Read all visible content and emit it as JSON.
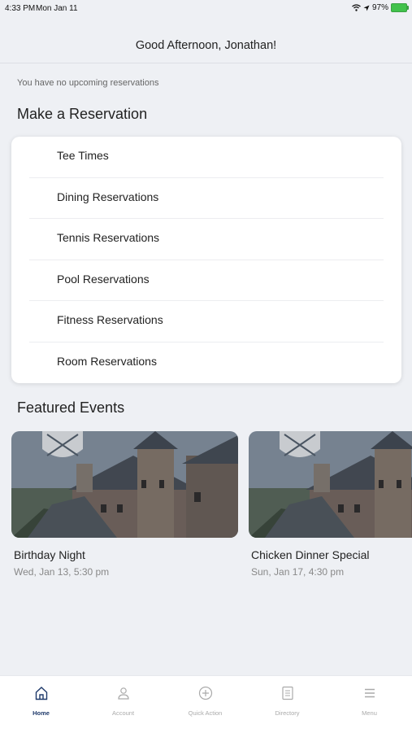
{
  "status": {
    "time": "4:33 PM",
    "date": "Mon Jan 11",
    "battery": "97%"
  },
  "header": {
    "greeting": "Good Afternoon, Jonathan!"
  },
  "reservations_notice": "You have no upcoming reservations",
  "make_reservation": {
    "title": "Make a Reservation",
    "items": [
      {
        "label": "Tee Times"
      },
      {
        "label": "Dining Reservations"
      },
      {
        "label": "Tennis Reservations"
      },
      {
        "label": "Pool Reservations"
      },
      {
        "label": "Fitness Reservations"
      },
      {
        "label": "Room Reservations"
      }
    ]
  },
  "featured_events": {
    "title": "Featured Events",
    "events": [
      {
        "title": "Birthday Night",
        "date": "Wed, Jan 13, 5:30 pm"
      },
      {
        "title": "Chicken Dinner Special",
        "date": "Sun, Jan 17, 4:30 pm"
      }
    ]
  },
  "tabs": [
    {
      "label": "Home",
      "icon": "home-icon",
      "active": true
    },
    {
      "label": "Account",
      "icon": "person-icon",
      "active": false
    },
    {
      "label": "Quick Action",
      "icon": "plus-circle-icon",
      "active": false
    },
    {
      "label": "Directory",
      "icon": "document-icon",
      "active": false
    },
    {
      "label": "Menu",
      "icon": "hamburger-icon",
      "active": false
    }
  ],
  "colors": {
    "accent": "#1f3a6b",
    "background": "#eef0f4",
    "battery": "#41c24b"
  }
}
